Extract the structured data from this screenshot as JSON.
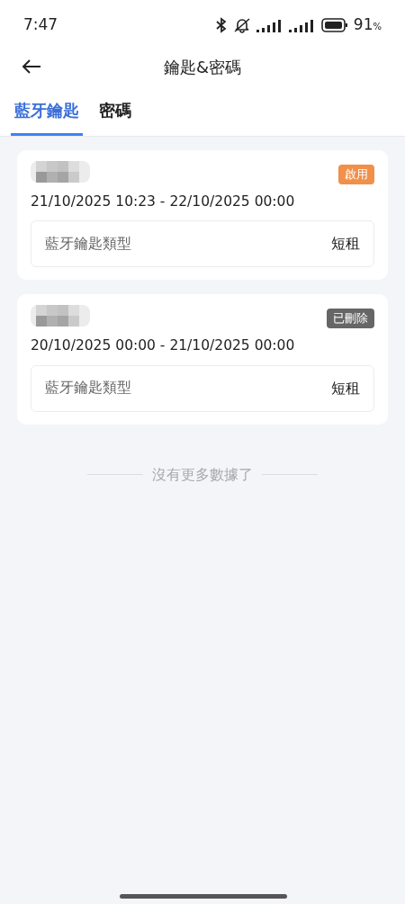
{
  "status_bar": {
    "time": "7:47",
    "battery": "91",
    "battery_unit": "%"
  },
  "header": {
    "title": "鑰匙&密碼"
  },
  "tabs": [
    {
      "label": "藍牙鑰匙",
      "selected": true
    },
    {
      "label": "密碼",
      "selected": false
    }
  ],
  "keys": [
    {
      "status": {
        "label": "啟用",
        "kind": "active"
      },
      "period": "21/10/2025 10:23 - 22/10/2025 00:00",
      "type_label": "藍牙鑰匙類型",
      "type_value": "短租"
    },
    {
      "status": {
        "label": "已刪除",
        "kind": "deleted"
      },
      "period": "20/10/2025 00:00 - 21/10/2025 00:00",
      "type_label": "藍牙鑰匙類型",
      "type_value": "短租"
    }
  ],
  "end_note": "沒有更多數據了"
}
